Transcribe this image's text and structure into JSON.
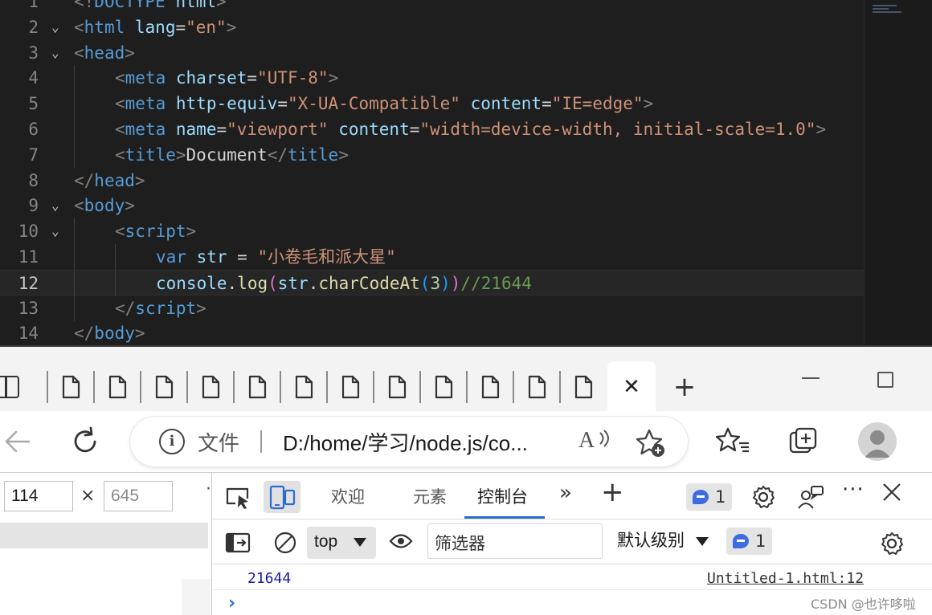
{
  "editor": {
    "lines": [
      {
        "n": "1",
        "fold": "",
        "indent": 0,
        "tokens": [
          [
            "t-punc",
            "<!"
          ],
          [
            "t-tag",
            "DOCTYPE"
          ],
          [
            "t-text",
            " "
          ],
          [
            "t-attr",
            "html"
          ],
          [
            "t-punc",
            ">"
          ]
        ]
      },
      {
        "n": "2",
        "fold": "⌄",
        "indent": 0,
        "tokens": [
          [
            "t-punc",
            "<"
          ],
          [
            "t-tag",
            "html"
          ],
          [
            "t-text",
            " "
          ],
          [
            "t-attr",
            "lang"
          ],
          [
            "t-text",
            "="
          ],
          [
            "t-str",
            "\"en\""
          ],
          [
            "t-punc",
            ">"
          ]
        ]
      },
      {
        "n": "3",
        "fold": "⌄",
        "indent": 0,
        "tokens": [
          [
            "t-punc",
            "<"
          ],
          [
            "t-tag",
            "head"
          ],
          [
            "t-punc",
            ">"
          ]
        ]
      },
      {
        "n": "4",
        "fold": "",
        "indent": 1,
        "tokens": [
          [
            "t-punc",
            "<"
          ],
          [
            "t-tag",
            "meta"
          ],
          [
            "t-text",
            " "
          ],
          [
            "t-attr",
            "charset"
          ],
          [
            "t-text",
            "="
          ],
          [
            "t-str",
            "\"UTF-8\""
          ],
          [
            "t-punc",
            ">"
          ]
        ]
      },
      {
        "n": "5",
        "fold": "",
        "indent": 1,
        "tokens": [
          [
            "t-punc",
            "<"
          ],
          [
            "t-tag",
            "meta"
          ],
          [
            "t-text",
            " "
          ],
          [
            "t-attr",
            "http-equiv"
          ],
          [
            "t-text",
            "="
          ],
          [
            "t-str",
            "\"X-UA-Compatible\""
          ],
          [
            "t-text",
            " "
          ],
          [
            "t-attr",
            "content"
          ],
          [
            "t-text",
            "="
          ],
          [
            "t-str",
            "\"IE=edge\""
          ],
          [
            "t-punc",
            ">"
          ]
        ]
      },
      {
        "n": "6",
        "fold": "",
        "indent": 1,
        "tokens": [
          [
            "t-punc",
            "<"
          ],
          [
            "t-tag",
            "meta"
          ],
          [
            "t-text",
            " "
          ],
          [
            "t-attr",
            "name"
          ],
          [
            "t-text",
            "="
          ],
          [
            "t-str",
            "\"viewport\""
          ],
          [
            "t-text",
            " "
          ],
          [
            "t-attr",
            "content"
          ],
          [
            "t-text",
            "="
          ],
          [
            "t-str",
            "\"width=device-width, initial-scale=1.0\""
          ],
          [
            "t-punc",
            ">"
          ]
        ]
      },
      {
        "n": "7",
        "fold": "",
        "indent": 1,
        "tokens": [
          [
            "t-punc",
            "<"
          ],
          [
            "t-tag",
            "title"
          ],
          [
            "t-punc",
            ">"
          ],
          [
            "t-text",
            "Document"
          ],
          [
            "t-punc",
            "</"
          ],
          [
            "t-tag",
            "title"
          ],
          [
            "t-punc",
            ">"
          ]
        ]
      },
      {
        "n": "8",
        "fold": "",
        "indent": 0,
        "tokens": [
          [
            "t-punc",
            "</"
          ],
          [
            "t-tag",
            "head"
          ],
          [
            "t-punc",
            ">"
          ]
        ]
      },
      {
        "n": "9",
        "fold": "⌄",
        "indent": 0,
        "tokens": [
          [
            "t-punc",
            "<"
          ],
          [
            "t-tag",
            "body"
          ],
          [
            "t-punc",
            ">"
          ]
        ]
      },
      {
        "n": "10",
        "fold": "⌄",
        "indent": 1,
        "tokens": [
          [
            "t-punc",
            "<"
          ],
          [
            "t-tag",
            "script"
          ],
          [
            "t-punc",
            ">"
          ]
        ]
      },
      {
        "n": "11",
        "fold": "",
        "indent": 2,
        "tokens": [
          [
            "t-kw",
            "var"
          ],
          [
            "t-text",
            " "
          ],
          [
            "t-var",
            "str"
          ],
          [
            "t-text",
            " = "
          ],
          [
            "t-str",
            "\"小卷毛和派大星\""
          ]
        ]
      },
      {
        "n": "12",
        "fold": "",
        "indent": 2,
        "current": true,
        "tokens": [
          [
            "t-var",
            "console"
          ],
          [
            "t-text",
            "."
          ],
          [
            "t-fn",
            "log"
          ],
          [
            "t-br1",
            "("
          ],
          [
            "t-var",
            "str"
          ],
          [
            "t-text",
            "."
          ],
          [
            "t-fn",
            "charCodeAt"
          ],
          [
            "t-br2",
            "("
          ],
          [
            "t-num",
            "3"
          ],
          [
            "t-br2",
            ")"
          ],
          [
            "t-br1",
            ")"
          ],
          [
            "t-com",
            "//21644"
          ]
        ]
      },
      {
        "n": "13",
        "fold": "",
        "indent": 1,
        "tokens": [
          [
            "t-punc",
            "</"
          ],
          [
            "t-tag",
            "script"
          ],
          [
            "t-punc",
            ">"
          ]
        ]
      },
      {
        "n": "14",
        "fold": "",
        "indent": 0,
        "tokens": [
          [
            "t-punc",
            "</"
          ],
          [
            "t-tag",
            "body"
          ],
          [
            "t-punc",
            ">"
          ]
        ]
      }
    ]
  },
  "browser": {
    "tabs_count": 12,
    "active_tab_close": "✕",
    "new_tab": "+",
    "address": {
      "scheme_label": "文件",
      "url": "D:/home/学习/node.js/co..."
    },
    "read_aloud": "A",
    "dimensions": {
      "width": "114",
      "height": "645",
      "times": "×"
    }
  },
  "devtools": {
    "tabs": {
      "welcome": "欢迎",
      "elements": "元素",
      "console": "控制台",
      "more": "»",
      "add": "+"
    },
    "issues_count": "1",
    "more_menu": "···",
    "console": {
      "context": "top",
      "filter_placeholder": "筛选器",
      "level": "默认级别",
      "issues_count": "1",
      "log_value": "21644",
      "log_source": "Untitled-1.html:12",
      "prompt": "›"
    }
  },
  "watermark": "CSDN @也许哆啦"
}
